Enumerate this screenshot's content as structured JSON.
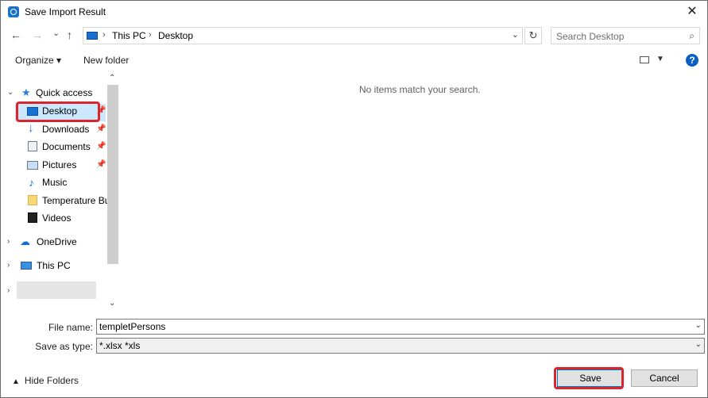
{
  "window": {
    "title": "Save Import Result",
    "close_glyph": "✕"
  },
  "nav": {
    "back_glyph": "←",
    "forward_glyph": "→",
    "recent_glyph": "⌄",
    "up_glyph": "↑",
    "breadcrumb": [
      "This PC",
      "Desktop"
    ],
    "separator": "›",
    "refresh_glyph": "↻",
    "search_placeholder": "Search Desktop",
    "search_glyph": "⌕"
  },
  "toolbar": {
    "organize_label": "Organize ▾",
    "new_folder_label": "New folder",
    "help_glyph": "?"
  },
  "sidebar": {
    "items": [
      {
        "label": "Quick access",
        "icon": "star-icon"
      },
      {
        "label": "Desktop",
        "icon": "desktop-icon",
        "pinned": true,
        "selected": true
      },
      {
        "label": "Downloads",
        "icon": "download-icon",
        "pinned": true
      },
      {
        "label": "Documents",
        "icon": "documents-icon",
        "pinned": true
      },
      {
        "label": "Pictures",
        "icon": "pictures-icon",
        "pinned": true
      },
      {
        "label": "Music",
        "icon": "music-icon"
      },
      {
        "label": "Temperature Bug",
        "icon": "folder-icon"
      },
      {
        "label": "Videos",
        "icon": "videos-icon"
      },
      {
        "label": "OneDrive",
        "icon": "cloud-icon"
      },
      {
        "label": "This PC",
        "icon": "computer-icon"
      }
    ],
    "pin_glyph": "📌"
  },
  "content": {
    "empty_message": "No items match your search."
  },
  "form": {
    "file_name_label": "File name:",
    "file_name_value": "templetPersons",
    "save_type_label": "Save as type:",
    "save_type_value": "*.xlsx *xls"
  },
  "footer": {
    "hide_folders_label": "Hide Folders",
    "save_label": "Save",
    "cancel_label": "Cancel"
  },
  "colors": {
    "selection": "#cce8ff",
    "highlight": "#d9262c",
    "accent": "#0078d7"
  }
}
